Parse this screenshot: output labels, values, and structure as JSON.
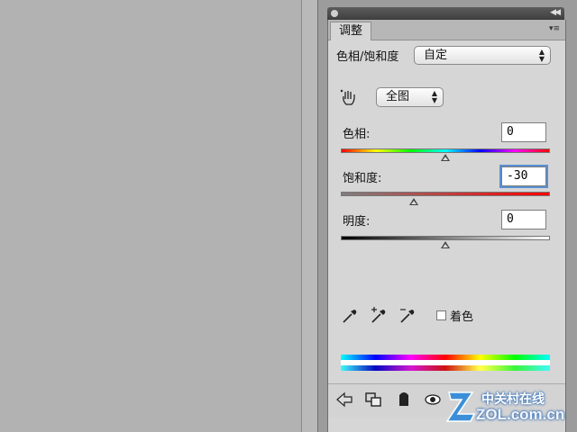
{
  "panel": {
    "tab_label": "调整",
    "section_title": "色相/饱和度",
    "preset_value": "自定",
    "channel_value": "全图",
    "hue_label": "色相:",
    "hue_value": "0",
    "saturation_label": "饱和度:",
    "saturation_value": "-30",
    "lightness_label": "明度:",
    "lightness_value": "0",
    "colorize_label": "着色"
  },
  "sliders": {
    "hue": 0,
    "saturation": -30,
    "lightness": 0
  },
  "colorize_checked": false,
  "icons": [
    "eyedropper-icon",
    "eyedropper-plus-icon",
    "eyedropper-minus-icon",
    "back-arrow-icon",
    "resize-icon",
    "mask-icon",
    "eye-icon",
    "reset-icon",
    "trash-icon",
    "panel-menu-icon",
    "collapse-icon",
    "targeted-adjustment-icon"
  ],
  "watermark": {
    "main": "ZOL.com.cn",
    "sub": "中关村在线"
  },
  "colors": {
    "focus": "#5a8fd4",
    "panel_bg": "#d6d6d6",
    "canvas_bg": "#b2b2b2"
  }
}
